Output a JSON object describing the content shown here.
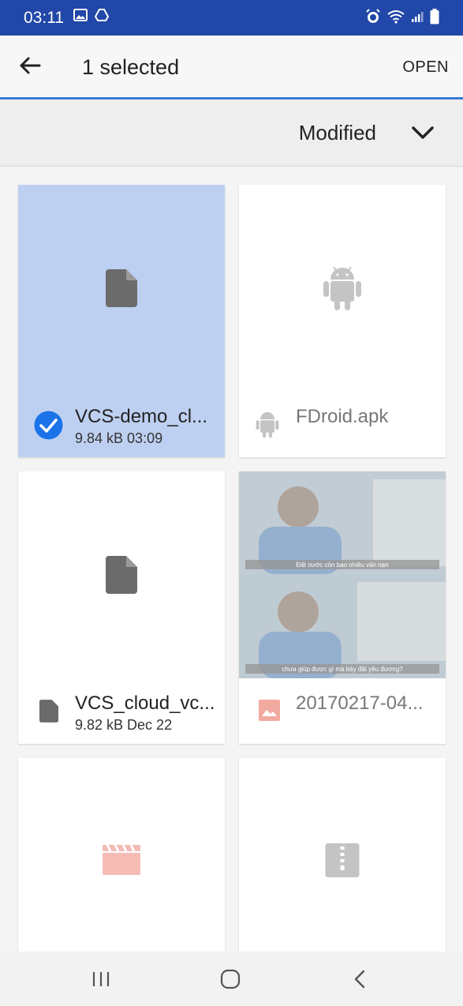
{
  "status_bar": {
    "time": "03:11",
    "left_icons": [
      "image-icon",
      "drive-icon"
    ],
    "right_icons": [
      "alarm-icon",
      "wifi-icon",
      "signal-icon",
      "battery-icon"
    ]
  },
  "app_bar": {
    "title": "1 selected",
    "open_label": "OPEN"
  },
  "sort": {
    "label": "Modified"
  },
  "files": [
    {
      "name": "VCS-demo_cl...",
      "meta": "9.84 kB 03:09",
      "type": "document",
      "selected": true
    },
    {
      "name": "FDroid.apk",
      "meta": "",
      "type": "android",
      "selected": false
    },
    {
      "name": "VCS_cloud_vc...",
      "meta": "9.82 kB Dec 22",
      "type": "document",
      "selected": false
    },
    {
      "name": "20170217-04...",
      "meta": "",
      "type": "image",
      "selected": false,
      "caption_top": "Đất nước còn bao nhiêu vấn nạn",
      "caption_bottom": "chưa giúp được gì mà bày đặt yêu đương?"
    },
    {
      "name": "",
      "meta": "",
      "type": "video",
      "selected": false
    },
    {
      "name": "",
      "meta": "",
      "type": "archive",
      "selected": false
    }
  ],
  "colors": {
    "status_bar": "#2147a8",
    "accent": "#3a7bd5",
    "selected_card": "#bed0f1",
    "check": "#1a73e8"
  }
}
